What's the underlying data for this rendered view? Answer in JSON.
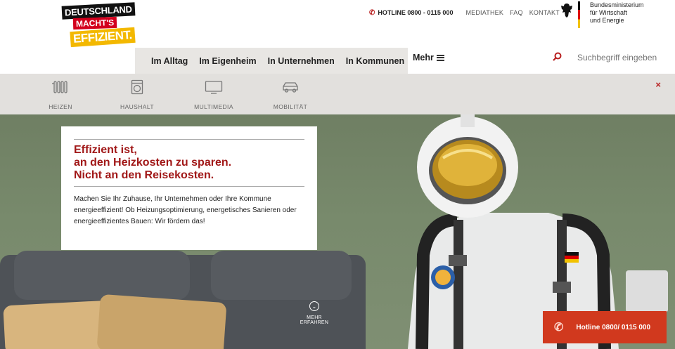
{
  "logo": {
    "line1": "DEUTSCHLAND",
    "line2": "MACHT'S",
    "line3": "EFFIZIENT."
  },
  "topnav": {
    "hotline": "HOTLINE 0800 - 0115 000",
    "links": [
      "MEDIATHEK",
      "FAQ",
      "KONTAKT"
    ]
  },
  "ministry": {
    "line1": "Bundesministerium",
    "line2": "für Wirtschaft",
    "line3": "und Energie"
  },
  "mainnav": {
    "items": [
      "Im Alltag",
      "Im Eigenheim",
      "In Unternehmen",
      "In Kommunen"
    ],
    "more": "Mehr"
  },
  "search": {
    "placeholder": "Suchbegriff eingeben"
  },
  "subnav": {
    "items": [
      {
        "label": "HEIZEN",
        "icon": "radiator-icon"
      },
      {
        "label": "HAUSHALT",
        "icon": "washing-machine-icon"
      },
      {
        "label": "MULTIMEDIA",
        "icon": "tv-icon"
      },
      {
        "label": "MOBILITÄT",
        "icon": "car-icon"
      }
    ],
    "close": "×"
  },
  "hero": {
    "headline_1": "Effizient ist,",
    "headline_2": "an den Heizkosten zu sparen.",
    "headline_3": "Nicht an den Reisekosten.",
    "body": "Machen Sie Ihr Zuhause, Ihr Unternehmen oder Ihre Kommune energieeffizient! Ob Heizungsoptimierung, energetisches Sanieren oder energieeffizientes Bauen: Wir fördern das!",
    "more_label": "MEHR ERFAHREN",
    "hotline_button": "Hotline 0800/ 0115 000"
  },
  "colors": {
    "accent": "#a11818",
    "hotline_bg": "#d1391e"
  }
}
